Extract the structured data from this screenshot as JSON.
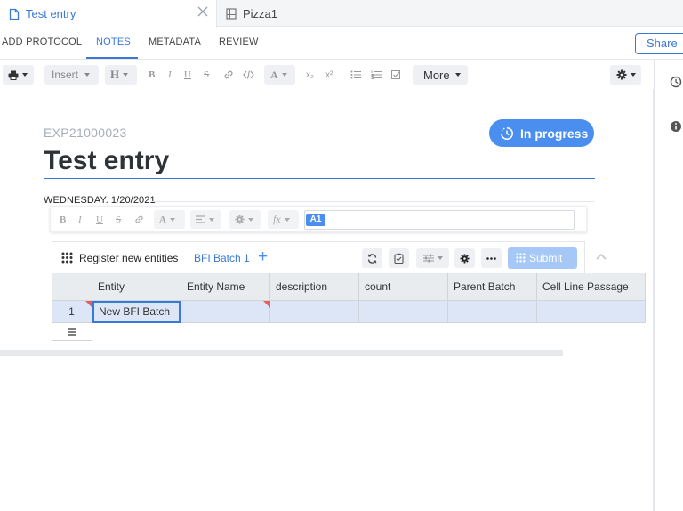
{
  "tabs": [
    {
      "label": "Test entry",
      "active": true
    },
    {
      "label": "Pizza1",
      "active": false
    }
  ],
  "subnav": {
    "items": [
      "ADD PROTOCOL",
      "NOTES",
      "METADATA",
      "REVIEW"
    ],
    "active": "NOTES",
    "share_label": "Share"
  },
  "toolbar": {
    "insert_label": "Insert",
    "heading_label": "H",
    "bold": "B",
    "italic": "I",
    "underline": "U",
    "strike": "S",
    "font_color": "A",
    "subscript": "x₂",
    "superscript": "x²",
    "more_label": "More"
  },
  "entry": {
    "id": "EXP21000023",
    "title": "Test entry",
    "status": "In progress",
    "date_label": "WEDNESDAY. 1/20/2021"
  },
  "sheet_toolbar": {
    "bold": "B",
    "italic": "I",
    "underline": "U",
    "strike": "S",
    "font_color": "A",
    "function": "fx",
    "cell_ref": "A1"
  },
  "entities": {
    "title": "Register new entities",
    "batch_name": "BFI Batch 1",
    "add_symbol": "+",
    "submit_label": "Submit",
    "columns": [
      "Entity",
      "Entity Name",
      "description",
      "count",
      "Parent Batch",
      "Cell Line Passage"
    ],
    "rows": [
      {
        "num": "1",
        "cells": [
          "New BFI Batch",
          "",
          "",
          "",
          "",
          ""
        ]
      }
    ]
  },
  "colors": {
    "accent": "#3a78d6",
    "status_pill": "#4a8ff0",
    "submit_disabled": "#a6c8f7",
    "required_flag": "#e5605c",
    "selected_row": "#dde6f7"
  }
}
